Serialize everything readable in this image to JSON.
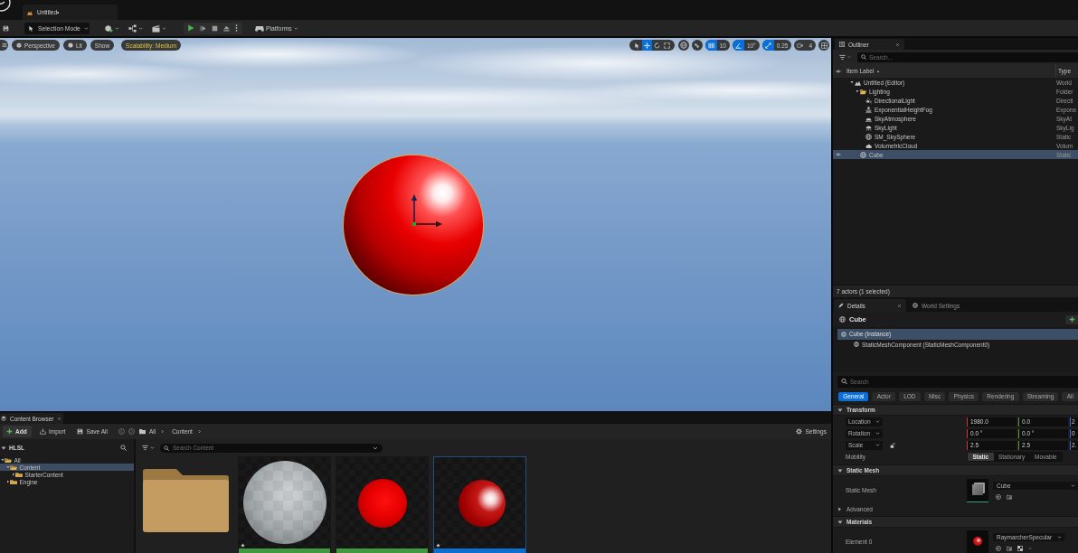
{
  "title_bar": {
    "tabs": [
      {
        "label": "Untitled•",
        "selected": true
      }
    ]
  },
  "toolbar": {
    "mode_button": "Selection Mode",
    "platforms_button": "Platforms"
  },
  "viewport": {
    "left_buttons": [
      {
        "kind": "menu"
      },
      {
        "kind": "camera-view",
        "label": "Perspective"
      },
      {
        "kind": "view-mode",
        "label": "Lit"
      },
      {
        "kind": "plain",
        "label": "Show"
      },
      {
        "kind": "warning",
        "label": "Scalability: Medium"
      }
    ],
    "transform_tools": [
      {
        "kind": "select",
        "selected": false
      },
      {
        "kind": "move",
        "selected": true
      },
      {
        "kind": "rotate",
        "selected": false
      },
      {
        "kind": "scale",
        "selected": false
      }
    ],
    "snaps": [
      {
        "kind": "grid",
        "value": "10",
        "on": true
      },
      {
        "kind": "angle",
        "value": "10°",
        "on": true
      },
      {
        "kind": "scale",
        "value": "0.25",
        "on": true
      },
      {
        "kind": "camera-speed",
        "value": "4",
        "on": false
      }
    ],
    "scene": {
      "selected": true
    }
  },
  "outliner": {
    "title": "Outliner",
    "search_placeholder": "Search...",
    "columns": [
      "Item Label",
      "Type"
    ],
    "items": [
      {
        "label": "Untitled (Editor)",
        "type": "World",
        "kind": "world",
        "selected": false,
        "expanded": true,
        "children": [
          {
            "label": "Lighting",
            "type": "Folder",
            "kind": "folder",
            "selected": false,
            "expanded": true,
            "children": [
              {
                "label": "DirectionalLight",
                "type": "Directi",
                "kind": "directional-light",
                "selected": false
              },
              {
                "label": "ExponentialHeightFog",
                "type": "Expone",
                "kind": "fog",
                "selected": false
              },
              {
                "label": "SkyAtmosphere",
                "type": "SkyAt",
                "kind": "atmosphere",
                "selected": false
              },
              {
                "label": "SkyLight",
                "type": "SkyLig",
                "kind": "skylight",
                "selected": false
              },
              {
                "label": "SM_SkySphere",
                "type": "Static",
                "kind": "mesh",
                "selected": false
              },
              {
                "label": "VolumetricCloud",
                "type": "Volum",
                "kind": "cloud",
                "selected": false
              }
            ]
          },
          {
            "label": "Cube",
            "type": "Static",
            "kind": "mesh",
            "selected": true
          }
        ]
      }
    ],
    "status": "7 actors (1 selected)"
  },
  "details": {
    "tabs": [
      {
        "label": "Details",
        "kind": "details",
        "selected": true
      },
      {
        "label": "World Settings",
        "kind": "world",
        "selected": false
      }
    ],
    "actor": "Cube",
    "components": [
      {
        "label": "Cube (Instance)",
        "selected": true,
        "children": [
          {
            "label": "StaticMeshComponent (StaticMeshComponent0)",
            "selected": false
          }
        ]
      }
    ],
    "search_placeholder": "Search",
    "categories": [
      {
        "label": "General",
        "selected": true
      },
      {
        "label": "Actor",
        "selected": false
      },
      {
        "label": "LOD",
        "selected": false
      },
      {
        "label": "Misc",
        "selected": false
      },
      {
        "label": "Physics",
        "selected": false
      },
      {
        "label": "Rendering",
        "selected": false
      },
      {
        "label": "Streaming",
        "selected": false
      },
      {
        "label": "All",
        "selected": false
      }
    ],
    "sections": [
      {
        "title": "Transform",
        "expanded": true,
        "rows": [
          {
            "kind": "vector",
            "label": "Location",
            "values": [
              "1980.0",
              "0.0",
              "2"
            ]
          },
          {
            "kind": "vector",
            "label": "Rotation",
            "values": [
              "0.0 °",
              "0.0 °",
              "0"
            ]
          },
          {
            "kind": "vector",
            "label": "Scale",
            "values": [
              "2.5",
              "2.5",
              "2."
            ],
            "ratio_locked": false
          },
          {
            "kind": "choice",
            "label": "Mobility",
            "options": [
              {
                "label": "Static",
                "selected": true
              },
              {
                "label": "Stationary",
                "selected": false
              },
              {
                "label": "Movable",
                "selected": false
              }
            ]
          }
        ]
      },
      {
        "title": "Static Mesh",
        "expanded": true,
        "rows": [
          {
            "kind": "mesh-asset",
            "label": "Static Mesh",
            "value": "Cube"
          },
          {
            "kind": "group",
            "label": "Advanced",
            "expanded": false
          }
        ]
      },
      {
        "title": "Materials",
        "expanded": true,
        "rows": [
          {
            "kind": "material-asset",
            "label": "Element 0",
            "value": "RaymarcherSpecular"
          }
        ]
      }
    ]
  },
  "content_browser": {
    "title": "Content Browser",
    "toolbar": [
      {
        "kind": "add",
        "label": "Add"
      },
      {
        "kind": "import",
        "label": "Import"
      },
      {
        "kind": "save",
        "label": "Save All"
      }
    ],
    "breadcrumbs": [
      "All",
      "Content"
    ],
    "settings": "Settings",
    "tree_header": {
      "label": "HLSL",
      "expanded": true
    },
    "tree": [
      {
        "label": "All",
        "expanded": true,
        "selected": false,
        "children": [
          {
            "label": "Content",
            "expanded": true,
            "selected": true,
            "children": [
              {
                "label": "StarterContent",
                "expanded": false,
                "selected": false
              }
            ]
          },
          {
            "label": "Engine",
            "expanded": false,
            "selected": false
          }
        ]
      }
    ],
    "search_placeholder": "Search Content",
    "assets": [
      {
        "kind": "folder",
        "selected": false,
        "modified": false
      },
      {
        "kind": "checker-sphere",
        "selected": false,
        "modified": true
      },
      {
        "kind": "matte-sphere",
        "selected": false,
        "modified": false
      },
      {
        "kind": "glossy-sphere",
        "selected": true,
        "modified": true
      }
    ]
  }
}
